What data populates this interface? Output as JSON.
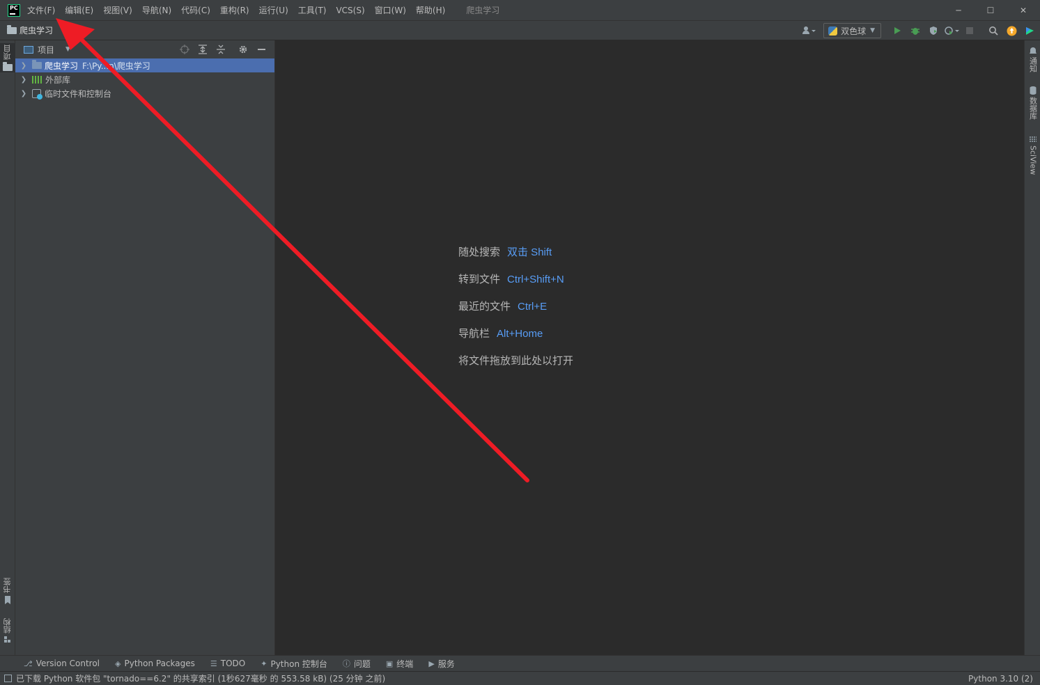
{
  "menu": {
    "logo": "PC",
    "items": [
      "文件(F)",
      "编辑(E)",
      "视图(V)",
      "导航(N)",
      "代码(C)",
      "重构(R)",
      "运行(U)",
      "工具(T)",
      "VCS(S)",
      "窗口(W)",
      "帮助(H)"
    ],
    "window_title": "爬虫学习"
  },
  "window_controls": {
    "minimize": "─",
    "maximize": "☐",
    "close": "✕"
  },
  "navbar": {
    "breadcrumb": "爬虫学习",
    "run_config": "双色球",
    "icons": [
      "account-icon",
      "python-icon",
      "run-icon",
      "debug-icon",
      "coverage-icon",
      "profile-icon",
      "stop-icon",
      "search-icon",
      "update-icon",
      "plugin-icon"
    ]
  },
  "left_strip": {
    "project": "项目",
    "bookmarks": "书签",
    "structure": "结构"
  },
  "project_panel": {
    "title": "项目",
    "tree": [
      {
        "label": "爬虫学习",
        "path": "F:\\Py...n\\爬虫学习",
        "selected": true
      },
      {
        "label": "外部库",
        "path": "",
        "selected": false
      },
      {
        "label": "临时文件和控制台",
        "path": "",
        "selected": false
      }
    ]
  },
  "editor": {
    "hints": [
      {
        "label": "随处搜索",
        "key": "双击 Shift"
      },
      {
        "label": "转到文件",
        "key": "Ctrl+Shift+N"
      },
      {
        "label": "最近的文件",
        "key": "Ctrl+E"
      },
      {
        "label": "导航栏",
        "key": "Alt+Home"
      },
      {
        "label": "将文件拖放到此处以打开",
        "key": ""
      }
    ]
  },
  "right_strip": {
    "notifications": "通知",
    "database": "数据库",
    "sciview": "SciView"
  },
  "bottom_tabs": [
    "Version Control",
    "Python Packages",
    "TODO",
    "Python 控制台",
    "问题",
    "终端",
    "服务"
  ],
  "status": {
    "message": "已下载 Python 软件包 \"tornado==6.2\" 的共享索引 (1秒627毫秒 的 553.58 kB) (25 分钟 之前)",
    "interpreter": "Python 3.10 (2)"
  },
  "colors": {
    "accent": "#4b6eaf",
    "link": "#589df6",
    "annotation_arrow": "#ee1c25"
  }
}
